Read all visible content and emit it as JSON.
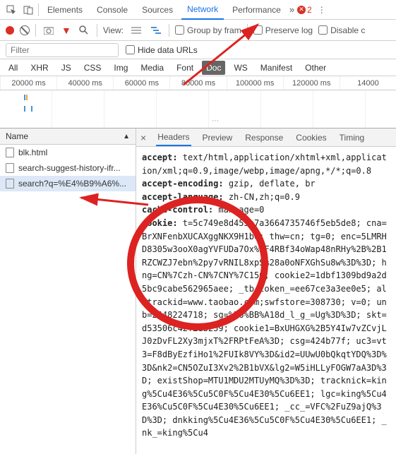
{
  "top": {
    "tabs": [
      "Elements",
      "Console",
      "Sources",
      "Network",
      "Performance"
    ],
    "active_tab": "Network",
    "errors": "2"
  },
  "toolbar": {
    "view_label": "View:",
    "group_label": "Group by fram",
    "preserve_label": "Preserve log",
    "disable_label": "Disable c"
  },
  "filter": {
    "placeholder": "Filter",
    "hide_label": "Hide data URLs"
  },
  "types": [
    "All",
    "XHR",
    "JS",
    "CSS",
    "Img",
    "Media",
    "Font",
    "Doc",
    "WS",
    "Manifest",
    "Other"
  ],
  "types_selected": "Doc",
  "timeline": [
    "20000 ms",
    "40000 ms",
    "60000 ms",
    "80000 ms",
    "100000 ms",
    "120000 ms",
    "14000"
  ],
  "namecol": {
    "header": "Name",
    "rows": [
      "blk.html",
      "search-suggest-history-ifr...",
      "search?q=%E4%B9%A6%..."
    ]
  },
  "detail_tabs": [
    "Headers",
    "Preview",
    "Response",
    "Cookies",
    "Timing"
  ],
  "detail_active": "Headers",
  "headers": {
    "accept_k": "accept:",
    "accept_v": " text/html,application/xhtml+xml,application/xml;q=0.9,image/webp,image/apng,*/*;q=0.8",
    "aenc_k": "accept-encoding:",
    "aenc_v": " gzip, deflate, br",
    "alang_k": "accept-language:",
    "alang_v": " zh-CN,zh;q=0.9",
    "cache_k": "cache-control:",
    "cache_v": " max-age=0",
    "cookie_k": "cookie:",
    "cookie_v": " t=5c749e8d453e7a3664735746f5eb5de8; cna=BrXNFenbXUCAXggNKX9H1bo; thw=cn; tg=0; enc=5LMRHD8305w3ooX0agYVFUDa7Ox%2F4RBf34oWap48nRHy%2B%2B1RZCWZJ7ebn%2py7vRNIL8xpS%28a0oNFXGhSu8w%3D%3D; hng=CN%7Czh-CN%7CNY%7C156; cookie2=1dbf1309bd9a2d5bc9cabe562965aee; _tb_token_=ee67ce3a3ee0e5; alitrackid=www.taobao.com;swfstore=308730; v=0; unb=2448224718; sg=%E6%BB%A18d_l_g_=Ug%3D%3D; skt=d53506c42f2db259; cookie1=BxUHGXG%2B5Y4Iw7vZCvjLJ0zDvFL2Xy3mjxT%2FRPtFeA%3D; csg=424b77f; uc3=vt3=F8dByEzfiHo1%2FUIk8VY%3D&id2=UUwU0bQkqtYDQ%3D%3D&nk2=CN5OZuI3Xv2%2B1bVX&lg2=W5iHLLyFOGW7aA3D%3D; existShop=MTU1MDU2MTUyMQ%3D%3D; tracknick=king%5Cu4E36%5Cu5C0F%5Cu4E30%5Cu6EE1; lgc=king%5Cu4E36%Cu5C0F%5Cu4E30%5Cu6EE1; _cc_=VFC%2FuZ9ajQ%3D%3D; dnkking%5Cu4E36%5Cu5C0F%5Cu4E30%5Cu6EE1; _nk_=king%5Cu4"
  }
}
